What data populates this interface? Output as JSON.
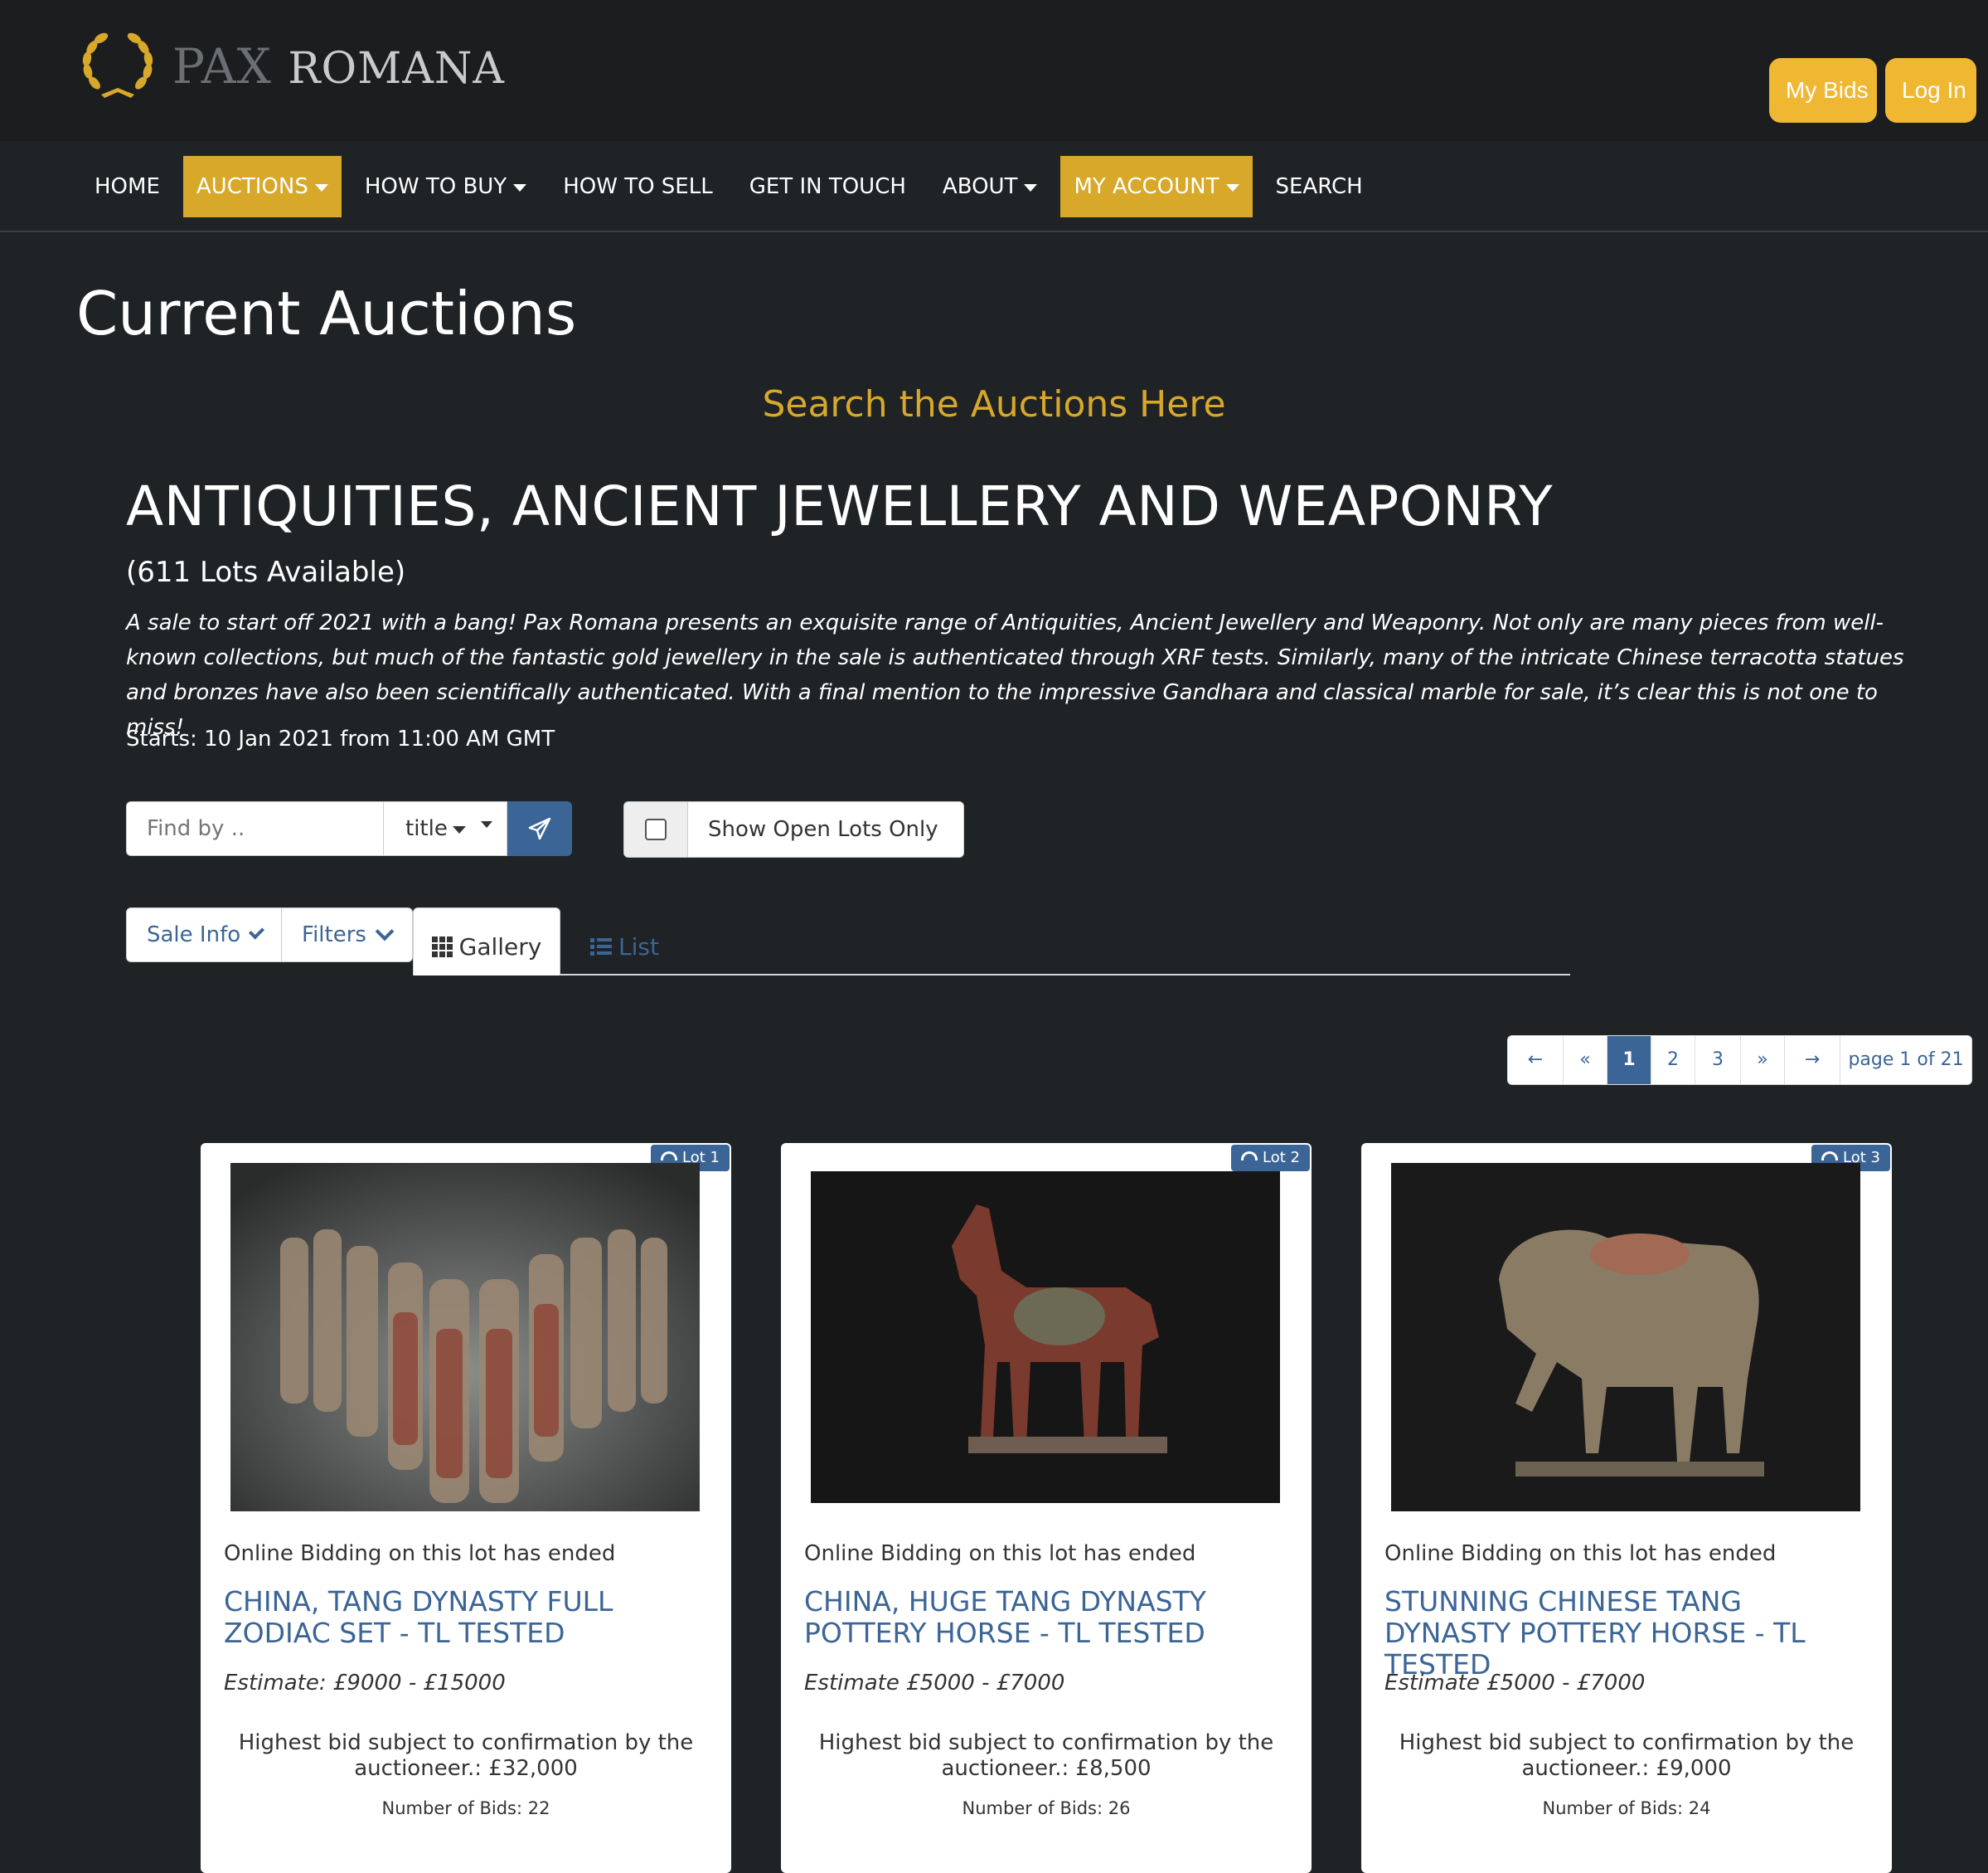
{
  "header": {
    "logo_pax": "PAX",
    "logo_romana": "ROMANA",
    "my_bids": "My Bids",
    "log_in": "Log In",
    "colors": {
      "accent": "#d7a82a",
      "button": "#f0b832",
      "link": "#3b6596"
    }
  },
  "nav": {
    "home": "HOME",
    "auctions": "AUCTIONS",
    "how_to_buy": "HOW TO BUY",
    "how_to_sell": "HOW TO SELL",
    "get_in_touch": "GET IN TOUCH",
    "about": "ABOUT",
    "my_account": "MY ACCOUNT",
    "search": "SEARCH"
  },
  "page": {
    "title": "Current Auctions",
    "search_link": "Search the Auctions Here"
  },
  "sale": {
    "title": "ANTIQUITIES, ANCIENT JEWELLERY AND WEAPONRY",
    "lots_available": "(611 Lots Available)",
    "description": "A sale to start off 2021 with a bang! Pax Romana presents an exquisite range of Antiquities, Ancient Jewellery and Weaponry. Not only are many pieces from well-known collections, but much of the fantastic gold jewellery in the sale is authenticated through XRF tests. Similarly, many of the intricate Chinese terracotta statues and bronzes have also been scientifically authenticated. With a final mention to the impressive Gandhara and classical marble for sale, it’s clear this is not one to miss!",
    "starts": "Starts: 10 Jan 2021 from 11:00 AM GMT"
  },
  "search": {
    "placeholder": "Find by ..",
    "field": "title",
    "show_open_lots": "Show Open Lots Only"
  },
  "tabs": {
    "sale_info": "Sale Info",
    "filters": "Filters",
    "gallery": "Gallery",
    "list": "List"
  },
  "pagination": {
    "prev": "←",
    "first": "«",
    "pages": [
      "1",
      "2",
      "3"
    ],
    "last": "»",
    "next": "→",
    "page_of": "page 1 of 21"
  },
  "lots": [
    {
      "badge": "Lot 1",
      "status": "Online Bidding on this lot has ended",
      "title": "CHINA, TANG DYNASTY FULL ZODIAC SET - TL TESTED",
      "estimate": "Estimate: £9000 - £15000",
      "high_bid": "Highest bid subject to confirmation by the auctioneer.: £32,000",
      "num_bids": "Number of Bids: 22"
    },
    {
      "badge": "Lot 2",
      "status": "Online Bidding on this lot has ended",
      "title": "CHINA, HUGE TANG DYNASTY POTTERY HORSE - TL TESTED",
      "estimate": "Estimate £5000 - £7000",
      "high_bid": "Highest bid subject to confirmation by the auctioneer.: £8,500",
      "num_bids": "Number of Bids: 26"
    },
    {
      "badge": "Lot 3",
      "status": "Online Bidding on this lot has ended",
      "title": "STUNNING CHINESE TANG DYNASTY POTTERY HORSE - TL TESTED",
      "estimate": "Estimate £5000 - £7000",
      "high_bid": "Highest bid subject to confirmation by the auctioneer.: £9,000",
      "num_bids": "Number of Bids: 24"
    }
  ]
}
